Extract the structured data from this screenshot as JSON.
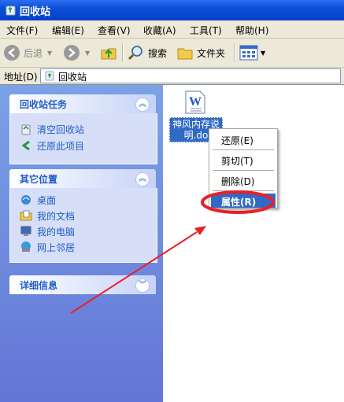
{
  "window": {
    "title": "回收站"
  },
  "menu": {
    "items": [
      "文件(F)",
      "编辑(E)",
      "查看(V)",
      "收藏(A)",
      "工具(T)",
      "帮助(H)"
    ]
  },
  "toolbar": {
    "back_label": "后退",
    "search_label": "搜索",
    "folders_label": "文件夹"
  },
  "address": {
    "label": "地址(D)",
    "value": "回收站"
  },
  "panels": {
    "recycle_tasks": {
      "title": "回收站任务",
      "items": [
        "清空回收站",
        "还原此项目"
      ]
    },
    "other_places": {
      "title": "其它位置",
      "items": [
        "桌面",
        "我的文档",
        "我的电脑",
        "网上邻居"
      ]
    },
    "details": {
      "title": "详细信息"
    }
  },
  "file": {
    "name_line1": "神风内存说",
    "name_line2": "明.do"
  },
  "context_menu": {
    "items": [
      "还原(E)",
      "剪切(T)",
      "删除(D)",
      "属性(R)"
    ]
  },
  "colors": {
    "highlight": "#316ac5",
    "annotation": "#e8202a",
    "titlebar": "#0a4fd8"
  }
}
